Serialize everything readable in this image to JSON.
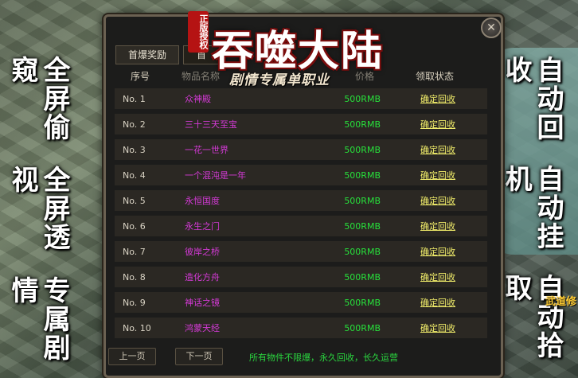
{
  "side_left": [
    "专属剧情",
    "全屏透视",
    "全屏偷窥"
  ],
  "side_right": [
    "自动拾取",
    "自动挂机",
    "自动回收"
  ],
  "side_label": "武道修",
  "logo": {
    "seal": "正版授权",
    "main": "吞噬大陆",
    "sub": "剧情专属单职业"
  },
  "tabs": [
    "首爆奖励",
    "首"
  ],
  "close_glyph": "✕",
  "header": {
    "no": "序号",
    "name": "物品名称",
    "price": "价格",
    "status": "领取状态"
  },
  "rows": [
    {
      "no": "No.  1",
      "name": "众神殿",
      "price": "500RMB",
      "action": "确定回收"
    },
    {
      "no": "No.  2",
      "name": "三十三天至宝",
      "price": "500RMB",
      "action": "确定回收"
    },
    {
      "no": "No.  3",
      "name": "一花一世界",
      "price": "500RMB",
      "action": "确定回收"
    },
    {
      "no": "No.  4",
      "name": "一个混沌是一年",
      "price": "500RMB",
      "action": "确定回收"
    },
    {
      "no": "No.  5",
      "name": "永恒国度",
      "price": "500RMB",
      "action": "确定回收"
    },
    {
      "no": "No.  6",
      "name": "永生之门",
      "price": "500RMB",
      "action": "确定回收"
    },
    {
      "no": "No.  7",
      "name": "彼岸之桥",
      "price": "500RMB",
      "action": "确定回收"
    },
    {
      "no": "No.  8",
      "name": "造化方舟",
      "price": "500RMB",
      "action": "确定回收"
    },
    {
      "no": "No.  9",
      "name": "神话之镜",
      "price": "500RMB",
      "action": "确定回收"
    },
    {
      "no": "No.  10",
      "name": "鸿蒙天经",
      "price": "500RMB",
      "action": "确定回收"
    }
  ],
  "footer": {
    "prev": "上一页",
    "next": "下一页",
    "note": "所有物件不限爆，永久回收，长久运营"
  },
  "colors": {
    "name": "#d43ad6",
    "price": "#27e13b",
    "action": "#f0ec6a",
    "note": "#2ad63f"
  }
}
